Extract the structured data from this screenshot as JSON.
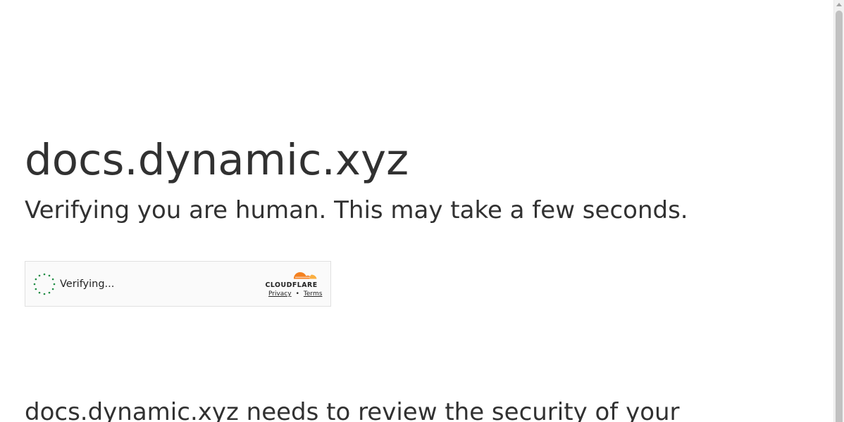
{
  "page": {
    "site_title": "docs.dynamic.xyz",
    "subtitle": "Verifying you are human. This may take a few seconds.",
    "bottom_text": "docs.dynamic.xyz needs to review the security of your"
  },
  "widget": {
    "status_text": "Verifying...",
    "brand": "CLOUDFLARE",
    "privacy_label": "Privacy",
    "separator": "•",
    "terms_label": "Terms",
    "spinner_color": "#1e8b42",
    "brand_orange": "#f48120",
    "brand_light_orange": "#faae40"
  },
  "icons": {
    "spinner": "loading-spinner-icon",
    "brand_logo": "cloudflare-cloud-icon",
    "scroll_up": "triangle-up-icon"
  }
}
